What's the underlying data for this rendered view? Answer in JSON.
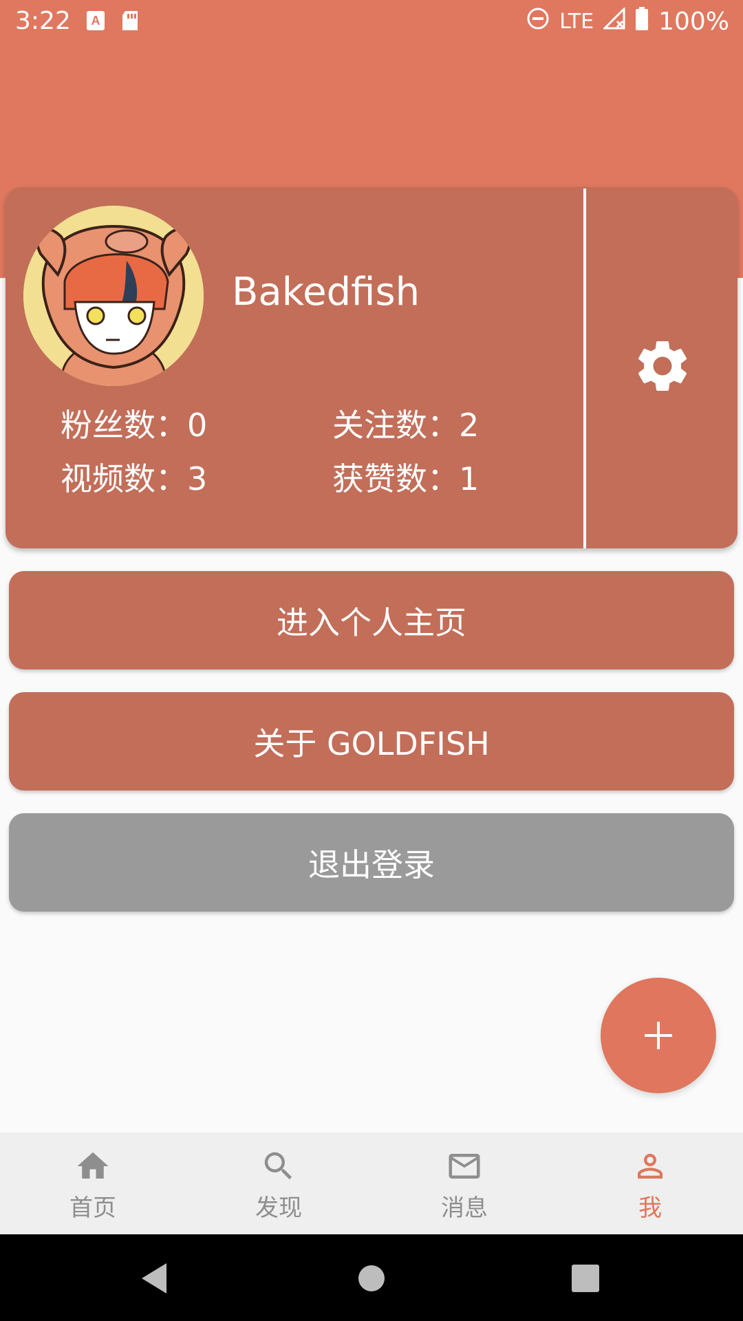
{
  "status_bar": {
    "time": "3:22",
    "network": "LTE",
    "battery": "100%"
  },
  "profile": {
    "username": "Bakedfish",
    "stats": {
      "fans": "粉丝数：0",
      "following": "关注数：2",
      "videos": "视频数：3",
      "likes": "获赞数：1"
    }
  },
  "actions": {
    "home_page": "进入个人主页",
    "about": "关于 GOLDFISH",
    "logout": "退出登录"
  },
  "fab": {
    "label": "+"
  },
  "bottom_nav": {
    "items": [
      {
        "label": "首页",
        "icon": "home-icon"
      },
      {
        "label": "发现",
        "icon": "search-icon"
      },
      {
        "label": "消息",
        "icon": "mail-icon"
      },
      {
        "label": "我",
        "icon": "person-icon"
      }
    ],
    "active_index": 3
  },
  "colors": {
    "header": "#df785f",
    "card": "#c26e59",
    "logout": "#9a9a9a",
    "active": "#df765d"
  }
}
